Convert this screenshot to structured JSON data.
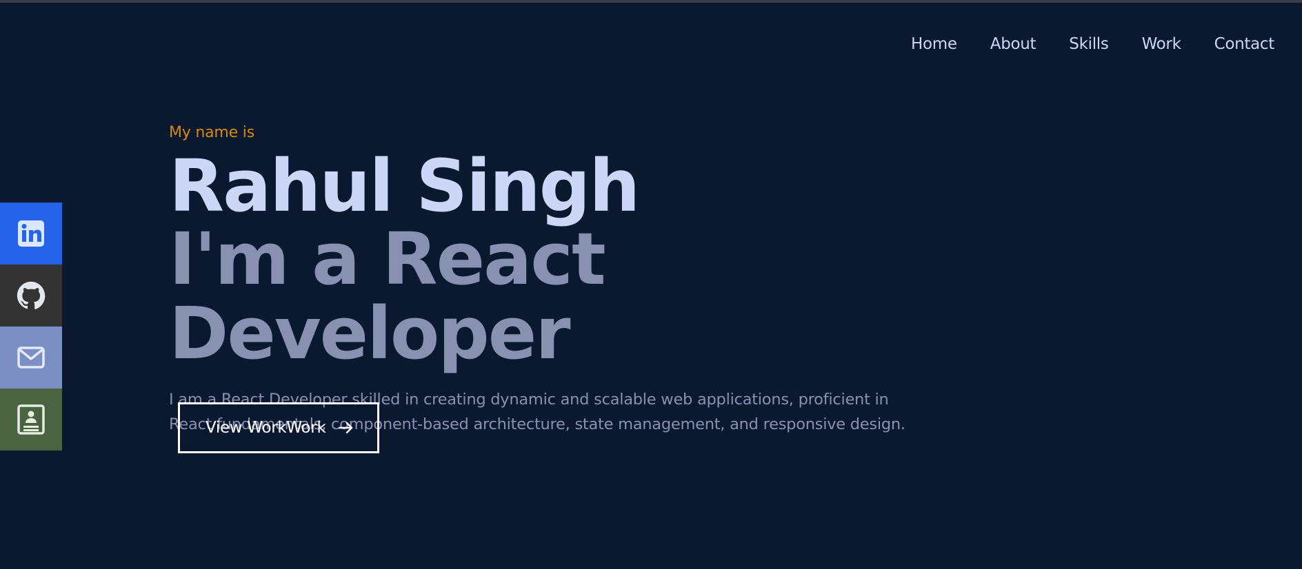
{
  "nav": {
    "items": [
      {
        "label": "Home"
      },
      {
        "label": "About"
      },
      {
        "label": "Skills"
      },
      {
        "label": "Work"
      },
      {
        "label": "Contact"
      }
    ]
  },
  "social": [
    {
      "icon": "linkedin-icon",
      "color": "#2563eb"
    },
    {
      "icon": "github-icon",
      "color": "#333333"
    },
    {
      "icon": "mail-icon",
      "color": "#7b8fc4"
    },
    {
      "icon": "resume-icon",
      "color": "#4a6340"
    }
  ],
  "hero": {
    "intro": "My name is",
    "name": "Rahul Singh",
    "role": "I'm a React Developer",
    "description": "I am a React Developer skilled in creating dynamic and scalable web applications, proficient in React fundamentals, component-based architecture, state management, and responsive design.",
    "cta_label": "View WorkWork"
  },
  "colors": {
    "background": "#0a192f",
    "accent": "#d98a12",
    "heading": "#ccd6f6",
    "muted": "#8892b0"
  }
}
